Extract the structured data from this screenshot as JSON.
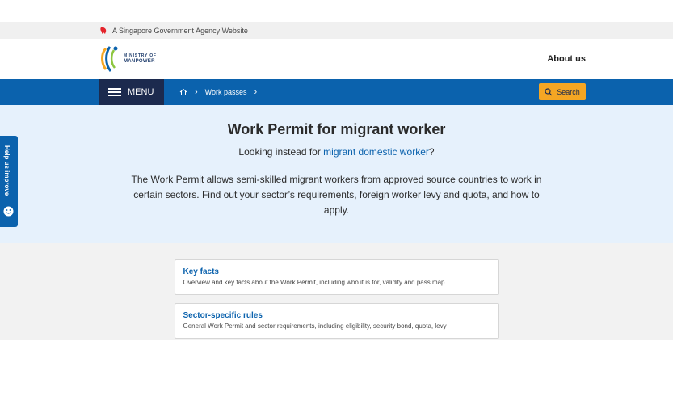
{
  "masthead": {
    "text": "A Singapore Government Agency Website"
  },
  "header": {
    "logo_line1": "MINISTRY OF",
    "logo_line2": "MANPOWER",
    "about_label": "About us"
  },
  "navbar": {
    "menu_label": "MENU",
    "breadcrumb": [
      "Work passes"
    ],
    "search_label": "Search"
  },
  "hero": {
    "title": "Work Permit for migrant worker",
    "alt_prefix": "Looking instead for ",
    "alt_link": "migrant domestic worker",
    "alt_suffix": "?",
    "description": "The Work Permit allows semi-skilled migrant workers from approved source countries to work in certain sectors. Find out your sector’s requirements, foreign worker levy and quota, and how to apply."
  },
  "cards": [
    {
      "title": "Key facts",
      "description": "Overview and key facts about the Work Permit, including who it is for, validity and pass map."
    },
    {
      "title": "Sector-specific rules",
      "description": "General Work Permit and sector requirements, including eligibility, security bond, quota, levy"
    }
  ],
  "feedback": {
    "label": "Help us improve"
  },
  "colors": {
    "primary": "#0b62ad",
    "menu": "#1c2a4e",
    "search": "#f5a623",
    "hero_bg": "#e6f1fc"
  },
  "icons": {
    "masthead": "lion-head-icon",
    "home": "home-icon",
    "search": "magnifier-icon",
    "menu": "hamburger-icon",
    "feedback": "smiley-icon"
  }
}
